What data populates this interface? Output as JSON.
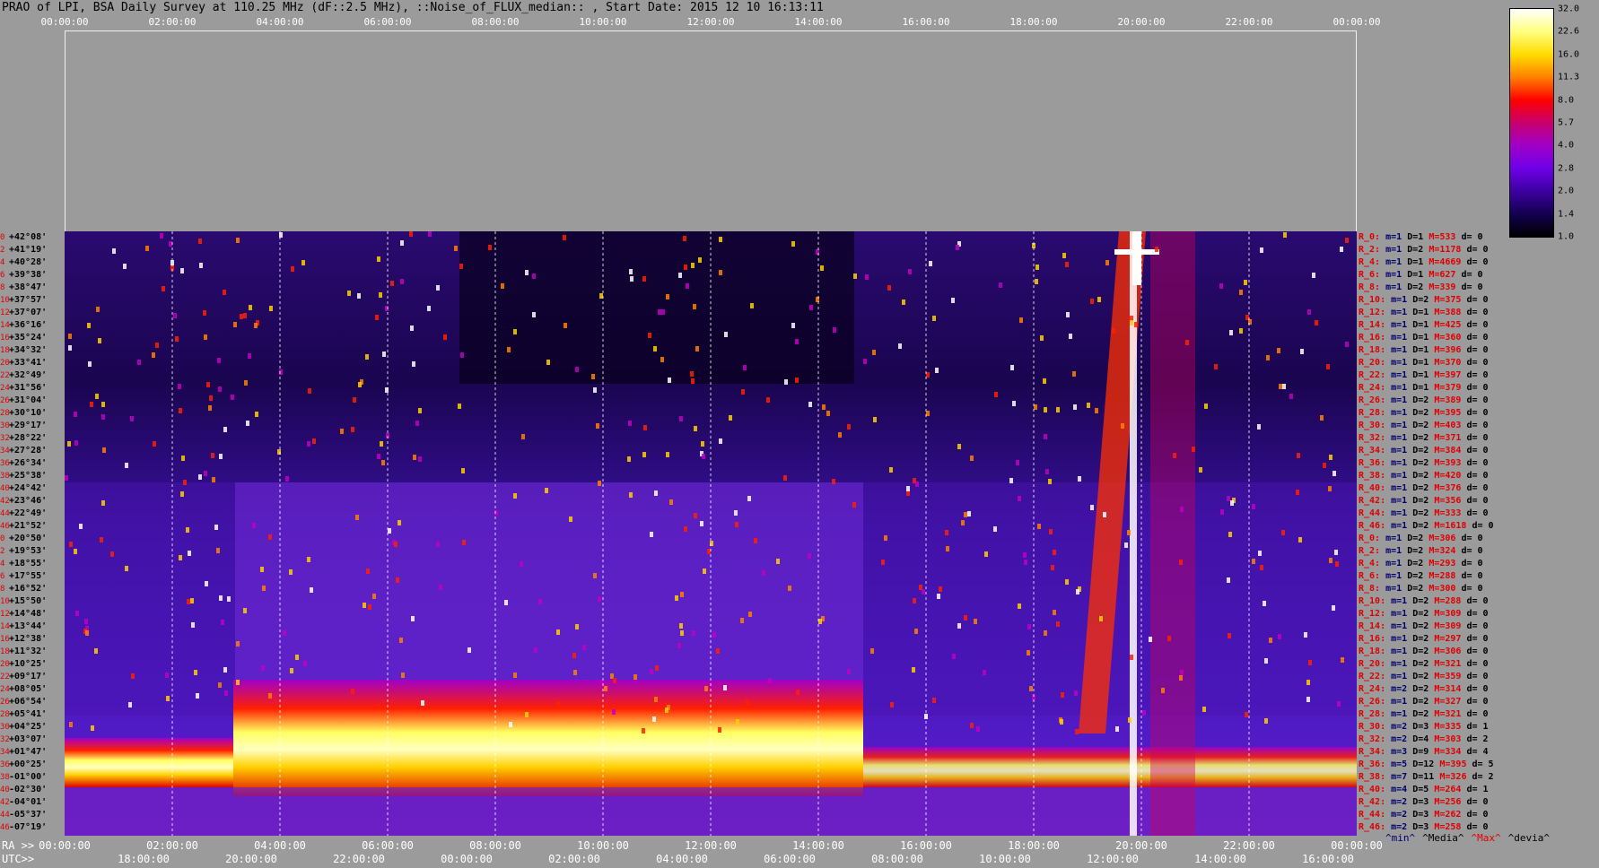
{
  "title": "PRAO of LPI, BSA Daily Survey at 110.25 MHz (dF::2.5 MHz), ::Noise_of_FLUX_median:: , Start Date: 2015 12 10 16:13:11",
  "top_axis": [
    "00:00:00",
    "02:00:00",
    "04:00:00",
    "06:00:00",
    "08:00:00",
    "10:00:00",
    "12:00:00",
    "14:00:00",
    "16:00:00",
    "18:00:00",
    "20:00:00",
    "22:00:00",
    "00:00:00"
  ],
  "bottom_axis": {
    "ra_label": "RA >>",
    "utc_label": "UTC>>",
    "ra": [
      "00:00:00",
      "02:00:00",
      "04:00:00",
      "06:00:00",
      "08:00:00",
      "10:00:00",
      "12:00:00",
      "14:00:00",
      "16:00:00",
      "18:00:00",
      "20:00:00",
      "22:00:00",
      "00:00:00"
    ],
    "utc": [
      "18:00:00",
      "20:00:00",
      "22:00:00",
      "00:00:00",
      "02:00:00",
      "04:00:00",
      "06:00:00",
      "08:00:00",
      "10:00:00",
      "12:00:00",
      "14:00:00",
      "16:00:00"
    ]
  },
  "colorbar": {
    "ticks": [
      "32.0",
      "22.6",
      "16.0",
      "11.3",
      "8.0",
      "5.7",
      "4.0",
      "2.8",
      "2.0",
      "1.4",
      "1.0"
    ],
    "colors": [
      "#ffffff",
      "#ffff80",
      "#ffdc00",
      "#ff8000",
      "#ff0000",
      "#c8006e",
      "#a000c8",
      "#6e00e6",
      "#3c00a0",
      "#140050",
      "#000000"
    ]
  },
  "declinations": [
    {
      "i": "0",
      "d": "+42°08'"
    },
    {
      "i": "2",
      "d": "+41°19'"
    },
    {
      "i": "4",
      "d": "+40°28'"
    },
    {
      "i": "6",
      "d": "+39°38'"
    },
    {
      "i": "8",
      "d": "+38°47'"
    },
    {
      "i": "10",
      "d": "+37°57'"
    },
    {
      "i": "12",
      "d": "+37°07'"
    },
    {
      "i": "14",
      "d": "+36°16'"
    },
    {
      "i": "16",
      "d": "+35°24'"
    },
    {
      "i": "18",
      "d": "+34°32'"
    },
    {
      "i": "20",
      "d": "+33°41'"
    },
    {
      "i": "22",
      "d": "+32°49'"
    },
    {
      "i": "24",
      "d": "+31°56'"
    },
    {
      "i": "26",
      "d": "+31°04'"
    },
    {
      "i": "28",
      "d": "+30°10'"
    },
    {
      "i": "30",
      "d": "+29°17'"
    },
    {
      "i": "32",
      "d": "+28°22'"
    },
    {
      "i": "34",
      "d": "+27°28'"
    },
    {
      "i": "36",
      "d": "+26°34'"
    },
    {
      "i": "38",
      "d": "+25°38'"
    },
    {
      "i": "40",
      "d": "+24°42'"
    },
    {
      "i": "42",
      "d": "+23°46'"
    },
    {
      "i": "44",
      "d": "+22°49'"
    },
    {
      "i": "46",
      "d": "+21°52'"
    },
    {
      "i": "0",
      "d": "+20°50'"
    },
    {
      "i": "2",
      "d": "+19°53'"
    },
    {
      "i": "4",
      "d": "+18°55'"
    },
    {
      "i": "6",
      "d": "+17°55'"
    },
    {
      "i": "8",
      "d": "+16°52'"
    },
    {
      "i": "10",
      "d": "+15°50'"
    },
    {
      "i": "12",
      "d": "+14°48'"
    },
    {
      "i": "14",
      "d": "+13°44'"
    },
    {
      "i": "16",
      "d": "+12°38'"
    },
    {
      "i": "18",
      "d": "+11°32'"
    },
    {
      "i": "20",
      "d": "+10°25'"
    },
    {
      "i": "22",
      "d": "+09°17'"
    },
    {
      "i": "24",
      "d": "+08°05'"
    },
    {
      "i": "26",
      "d": "+06°54'"
    },
    {
      "i": "28",
      "d": "+05°41'"
    },
    {
      "i": "30",
      "d": "+04°25'"
    },
    {
      "i": "32",
      "d": "+03°07'"
    },
    {
      "i": "34",
      "d": "+01°47'"
    },
    {
      "i": "36",
      "d": "+00°25'"
    },
    {
      "i": "38",
      "d": "-01°00'"
    },
    {
      "i": "40",
      "d": "-02°30'"
    },
    {
      "i": "42",
      "d": "-04°01'"
    },
    {
      "i": "44",
      "d": "-05°37'"
    },
    {
      "i": "46",
      "d": "-07°19'"
    }
  ],
  "rows": [
    {
      "r": "R_0:",
      "m": "m=1",
      "D": "D=1",
      "M": "M=533",
      "d": "d= 0"
    },
    {
      "r": "R_2:",
      "m": "m=1",
      "D": "D=2",
      "M": "M=1178",
      "d": "d= 0"
    },
    {
      "r": "R_4:",
      "m": "m=1",
      "D": "D=1",
      "M": "M=4669",
      "d": "d= 0"
    },
    {
      "r": "R_6:",
      "m": "m=1",
      "D": "D=1",
      "M": "M=627",
      "d": "d= 0"
    },
    {
      "r": "R_8:",
      "m": "m=1",
      "D": "D=2",
      "M": "M=339",
      "d": "d= 0"
    },
    {
      "r": "R_10:",
      "m": "m=1",
      "D": "D=2",
      "M": "M=375",
      "d": "d= 0"
    },
    {
      "r": "R_12:",
      "m": "m=1",
      "D": "D=1",
      "M": "M=388",
      "d": "d= 0"
    },
    {
      "r": "R_14:",
      "m": "m=1",
      "D": "D=1",
      "M": "M=425",
      "d": "d= 0"
    },
    {
      "r": "R_16:",
      "m": "m=1",
      "D": "D=1",
      "M": "M=360",
      "d": "d= 0"
    },
    {
      "r": "R_18:",
      "m": "m=1",
      "D": "D=1",
      "M": "M=396",
      "d": "d= 0"
    },
    {
      "r": "R_20:",
      "m": "m=1",
      "D": "D=1",
      "M": "M=370",
      "d": "d= 0"
    },
    {
      "r": "R_22:",
      "m": "m=1",
      "D": "D=1",
      "M": "M=397",
      "d": "d= 0"
    },
    {
      "r": "R_24:",
      "m": "m=1",
      "D": "D=1",
      "M": "M=379",
      "d": "d= 0"
    },
    {
      "r": "R_26:",
      "m": "m=1",
      "D": "D=2",
      "M": "M=389",
      "d": "d= 0"
    },
    {
      "r": "R_28:",
      "m": "m=1",
      "D": "D=2",
      "M": "M=395",
      "d": "d= 0"
    },
    {
      "r": "R_30:",
      "m": "m=1",
      "D": "D=2",
      "M": "M=403",
      "d": "d= 0"
    },
    {
      "r": "R_32:",
      "m": "m=1",
      "D": "D=2",
      "M": "M=371",
      "d": "d= 0"
    },
    {
      "r": "R_34:",
      "m": "m=1",
      "D": "D=2",
      "M": "M=384",
      "d": "d= 0"
    },
    {
      "r": "R_36:",
      "m": "m=1",
      "D": "D=2",
      "M": "M=393",
      "d": "d= 0"
    },
    {
      "r": "R_38:",
      "m": "m=1",
      "D": "D=2",
      "M": "M=420",
      "d": "d= 0"
    },
    {
      "r": "R_40:",
      "m": "m=1",
      "D": "D=2",
      "M": "M=376",
      "d": "d= 0"
    },
    {
      "r": "R_42:",
      "m": "m=1",
      "D": "D=2",
      "M": "M=356",
      "d": "d= 0"
    },
    {
      "r": "R_44:",
      "m": "m=1",
      "D": "D=2",
      "M": "M=333",
      "d": "d= 0"
    },
    {
      "r": "R_46:",
      "m": "m=1",
      "D": "D=2",
      "M": "M=1618",
      "d": "d= 0"
    },
    {
      "r": "R_0:",
      "m": "m=1",
      "D": "D=2",
      "M": "M=306",
      "d": "d= 0"
    },
    {
      "r": "R_2:",
      "m": "m=1",
      "D": "D=2",
      "M": "M=324",
      "d": "d= 0"
    },
    {
      "r": "R_4:",
      "m": "m=1",
      "D": "D=2",
      "M": "M=293",
      "d": "d= 0"
    },
    {
      "r": "R_6:",
      "m": "m=1",
      "D": "D=2",
      "M": "M=288",
      "d": "d= 0"
    },
    {
      "r": "R_8:",
      "m": "m=1",
      "D": "D=2",
      "M": "M=300",
      "d": "d= 0"
    },
    {
      "r": "R_10:",
      "m": "m=1",
      "D": "D=2",
      "M": "M=288",
      "d": "d= 0"
    },
    {
      "r": "R_12:",
      "m": "m=1",
      "D": "D=2",
      "M": "M=309",
      "d": "d= 0"
    },
    {
      "r": "R_14:",
      "m": "m=1",
      "D": "D=2",
      "M": "M=309",
      "d": "d= 0"
    },
    {
      "r": "R_16:",
      "m": "m=1",
      "D": "D=2",
      "M": "M=297",
      "d": "d= 0"
    },
    {
      "r": "R_18:",
      "m": "m=1",
      "D": "D=2",
      "M": "M=306",
      "d": "d= 0"
    },
    {
      "r": "R_20:",
      "m": "m=1",
      "D": "D=2",
      "M": "M=321",
      "d": "d= 0"
    },
    {
      "r": "R_22:",
      "m": "m=1",
      "D": "D=2",
      "M": "M=359",
      "d": "d= 0"
    },
    {
      "r": "R_24:",
      "m": "m=2",
      "D": "D=2",
      "M": "M=314",
      "d": "d= 0"
    },
    {
      "r": "R_26:",
      "m": "m=1",
      "D": "D=2",
      "M": "M=327",
      "d": "d= 0"
    },
    {
      "r": "R_28:",
      "m": "m=1",
      "D": "D=2",
      "M": "M=321",
      "d": "d= 0"
    },
    {
      "r": "R_30:",
      "m": "m=2",
      "D": "D=3",
      "M": "M=335",
      "d": "d= 1"
    },
    {
      "r": "R_32:",
      "m": "m=2",
      "D": "D=4",
      "M": "M=303",
      "d": "d= 2"
    },
    {
      "r": "R_34:",
      "m": "m=3",
      "D": "D=9",
      "M": "M=334",
      "d": "d= 4"
    },
    {
      "r": "R_36:",
      "m": "m=5",
      "D": "D=12",
      "M": "M=395",
      "d": "d= 5"
    },
    {
      "r": "R_38:",
      "m": "m=7",
      "D": "D=11",
      "M": "M=326",
      "d": "d= 2"
    },
    {
      "r": "R_40:",
      "m": "m=4",
      "D": "D=5",
      "M": "M=264",
      "d": "d= 1"
    },
    {
      "r": "R_42:",
      "m": "m=2",
      "D": "D=3",
      "M": "M=256",
      "d": "d= 0"
    },
    {
      "r": "R_44:",
      "m": "m=2",
      "D": "D=3",
      "M": "M=262",
      "d": "d= 0"
    },
    {
      "r": "R_46:",
      "m": "m=2",
      "D": "D=3",
      "M": "M=258",
      "d": "d= 0"
    }
  ],
  "legend": [
    {
      "label": "^min^",
      "color": "#00006e"
    },
    {
      "label": "^Media^",
      "color": "#000000"
    },
    {
      "label": "^Max^",
      "color": "#e00000"
    },
    {
      "label": "^devia^",
      "color": "#000000"
    }
  ]
}
